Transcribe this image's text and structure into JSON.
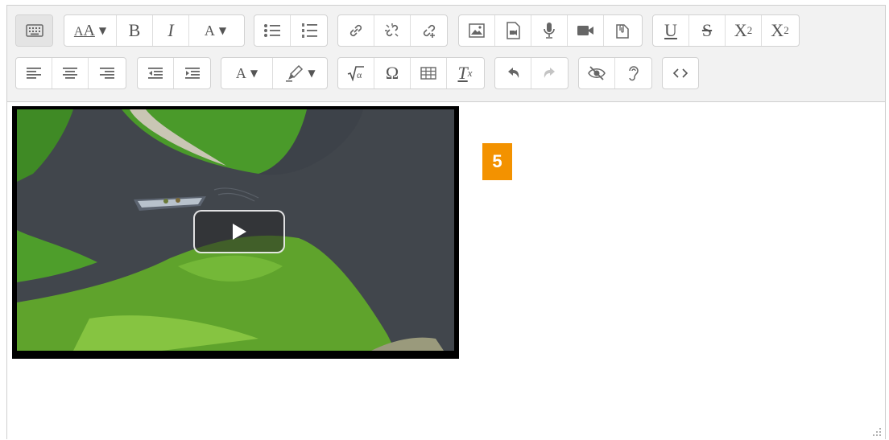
{
  "toolbar": {
    "row1": {
      "font_size_label": "A",
      "bold_label": "B",
      "italic_label": "I",
      "text_style_label": "A",
      "underline_label": "U",
      "strike_label": "S",
      "subscript_base": "X",
      "subscript_mark": "2",
      "superscript_base": "X",
      "superscript_mark": "2"
    },
    "row2": {
      "font_color_label": "A",
      "omega_label": "Ω",
      "clear_format_label": "T",
      "clear_format_sub": "x"
    }
  },
  "content": {
    "marker_label": "5"
  },
  "colors": {
    "toolbar_bg": "#f2f2f2",
    "marker_bg": "#f39200",
    "water": "#3c4147",
    "foliage": "#5fa32c"
  }
}
